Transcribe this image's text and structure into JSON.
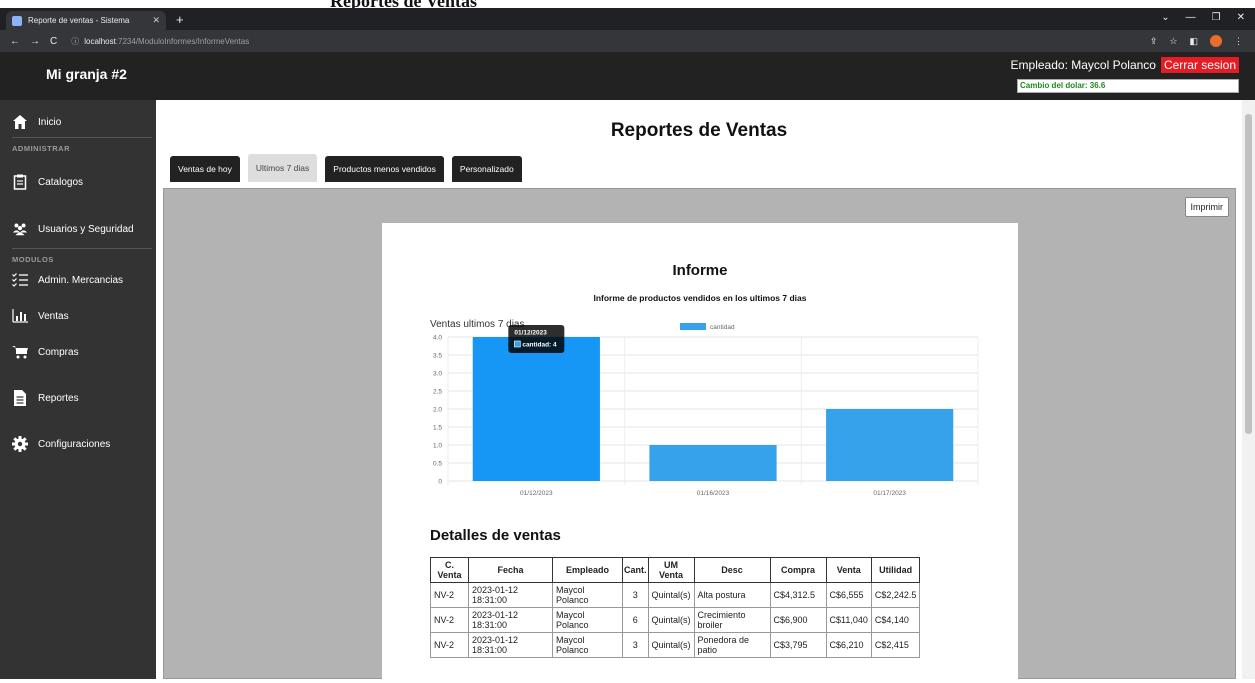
{
  "browser": {
    "tab_title": "Reporte de ventas - Sistema",
    "url_host": "localhost",
    "url_rest": ":7234/ModuloInformes/InformeVentas",
    "top_text": "Reportes de Ventas"
  },
  "header": {
    "brand": "Mi granja #2",
    "employee": "Empleado: Maycol Polanco",
    "logout": "Cerrar sesion",
    "exchange_rate": "Cambio del dolar: 36.6"
  },
  "sidebar": {
    "inicio": "Inicio",
    "section_admin": "ADMINISTRAR",
    "catalogos": "Catalogos",
    "usuarios": "Usuarios y Seguridad",
    "section_modulos": "MODULOS",
    "mercancias": "Admin. Mercancias",
    "ventas": "Ventas",
    "compras": "Compras",
    "reportes": "Reportes",
    "config": "Configuraciones",
    "icons": [
      "home-icon",
      "clipboard-icon",
      "users-icon",
      "list-check-icon",
      "bar-chart-icon",
      "cart-icon",
      "document-icon",
      "gear-icon"
    ]
  },
  "main": {
    "title": "Reportes de Ventas",
    "tabs": [
      "Ventas de hoy",
      "Ultimos 7 dias",
      "Productos menos vendidos",
      "Personalizado"
    ],
    "print": "Imprimir"
  },
  "report": {
    "title": "Informe",
    "subtitle": "Informe de productos vendidos en los ultimos 7 dias",
    "chart_label": "Ventas ultimos 7 dias",
    "tooltip_title": "01/12/2023",
    "tooltip_body": "cantidad: 4",
    "details_title": "Detalles de ventas",
    "table": {
      "headers": [
        "C. Venta",
        "Fecha",
        "Empleado",
        "Cant.",
        "UM Venta",
        "Desc",
        "Compra",
        "Venta",
        "Utilidad"
      ],
      "rows": [
        [
          "NV-2",
          "2023-01-12 18:31:00",
          "Maycol Polanco",
          "3",
          "Quintal(s)",
          "Alta postura",
          "C$4,312.5",
          "C$6,555",
          "C$2,242.5"
        ],
        [
          "NV-2",
          "2023-01-12 18:31:00",
          "Maycol Polanco",
          "6",
          "Quintal(s)",
          "Crecimiento broiler",
          "C$6,900",
          "C$11,040",
          "C$4,140"
        ],
        [
          "NV-2",
          "2023-01-12 18:31:00",
          "Maycol Polanco",
          "3",
          "Quintal(s)",
          "Ponedora de patio",
          "C$3,795",
          "C$6,210",
          "C$2,415"
        ]
      ]
    }
  },
  "chart_data": {
    "type": "bar",
    "title": "Ventas ultimos 7 dias",
    "categories": [
      "01/12/2023",
      "01/16/2023",
      "01/17/2023"
    ],
    "series": [
      {
        "name": "cantidad",
        "values": [
          4,
          1,
          2
        ]
      }
    ],
    "ylim": [
      0,
      4
    ],
    "yticks": [
      "0",
      "0.5",
      "1.0",
      "1.5",
      "2.0",
      "2.5",
      "3.0",
      "3.5",
      "4.0"
    ],
    "legend": "top",
    "grid": true,
    "color": "#36a2eb",
    "highlight_color": "#1696f5"
  }
}
